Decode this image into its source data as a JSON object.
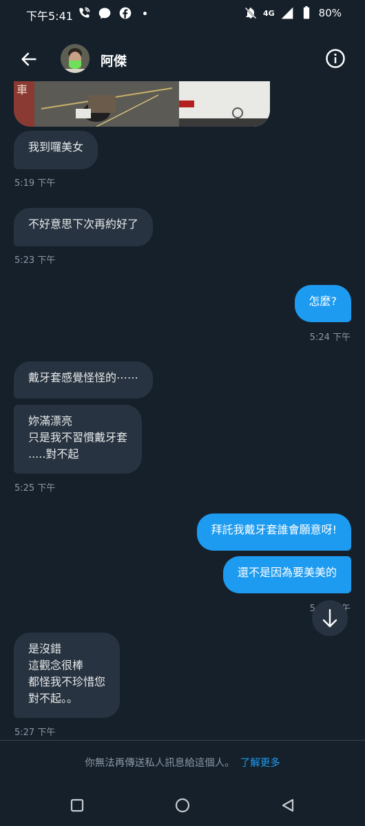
{
  "status_bar": {
    "time": "下午5:41",
    "network": "4G",
    "battery": "80%"
  },
  "header": {
    "contact_name": "阿傑"
  },
  "messages": [
    {
      "id": "m1",
      "dir": "in",
      "text": "我到囉美女"
    },
    {
      "id": "t1",
      "time": "5:19 下午"
    },
    {
      "id": "m2",
      "dir": "in",
      "text": "不好意思下次再約好了"
    },
    {
      "id": "t2",
      "time": "5:23 下午"
    },
    {
      "id": "m3",
      "dir": "out",
      "text": "怎麼?"
    },
    {
      "id": "t3",
      "time": "5:24 下午"
    },
    {
      "id": "m4",
      "dir": "in",
      "text": "戴牙套感覺怪怪的⋯⋯"
    },
    {
      "id": "m5",
      "dir": "in",
      "text": "妳滿漂亮\n只是我不習慣戴牙套\n.....對不起"
    },
    {
      "id": "t4",
      "time": "5:25 下午"
    },
    {
      "id": "m6",
      "dir": "out",
      "text": "拜託我戴牙套誰會願意呀!"
    },
    {
      "id": "m7",
      "dir": "out",
      "text": "還不是因為要美美的"
    },
    {
      "id": "t5",
      "time": "5:26 下午"
    },
    {
      "id": "m8",
      "dir": "in",
      "text": "是沒錯\n這觀念很棒\n都怪我不珍惜您\n對不起。。"
    },
    {
      "id": "t6",
      "time": "5:27 下午"
    }
  ],
  "notice": {
    "text": "你無法再傳送私人訊息給這個人。",
    "link": "了解更多"
  },
  "icons": {
    "back": "arrow-left-icon",
    "info": "info-icon",
    "scroll": "arrow-down-icon"
  },
  "colors": {
    "background": "#15202b",
    "incoming_bubble": "#273340",
    "outgoing_bubble": "#1d9bf0",
    "muted_text": "#8b98a5"
  }
}
